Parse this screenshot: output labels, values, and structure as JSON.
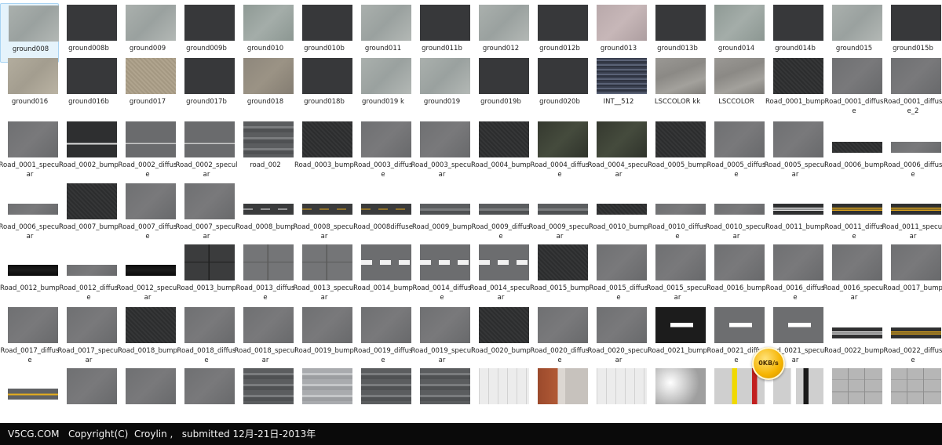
{
  "files": [
    {
      "label": "ground008",
      "tex": "tex-gray-light",
      "selected": true
    },
    {
      "label": "ground008b",
      "tex": "tex-dark"
    },
    {
      "label": "ground009",
      "tex": "tex-gray-light"
    },
    {
      "label": "ground009b",
      "tex": "tex-dark"
    },
    {
      "label": "ground010",
      "tex": "tex-gray-green"
    },
    {
      "label": "ground010b",
      "tex": "tex-dark"
    },
    {
      "label": "ground011",
      "tex": "tex-gray-light"
    },
    {
      "label": "ground011b",
      "tex": "tex-dark"
    },
    {
      "label": "ground012",
      "tex": "tex-gray-light"
    },
    {
      "label": "ground012b",
      "tex": "tex-dark"
    },
    {
      "label": "ground013",
      "tex": "tex-pink"
    },
    {
      "label": "ground013b",
      "tex": "tex-dark"
    },
    {
      "label": "ground014",
      "tex": "tex-gray-green"
    },
    {
      "label": "ground014b",
      "tex": "tex-dark"
    },
    {
      "label": "ground015",
      "tex": "tex-gray-light"
    },
    {
      "label": "ground015b",
      "tex": "tex-dark"
    },
    {
      "label": "ground016",
      "tex": "tex-beige"
    },
    {
      "label": "ground016b",
      "tex": "tex-dark"
    },
    {
      "label": "ground017",
      "tex": "tex-sand"
    },
    {
      "label": "ground017b",
      "tex": "tex-dark"
    },
    {
      "label": "ground018",
      "tex": "tex-brown-gray"
    },
    {
      "label": "ground018b",
      "tex": "tex-dark"
    },
    {
      "label": "ground019 k",
      "tex": "tex-gray-light"
    },
    {
      "label": "ground019",
      "tex": "tex-gray-light"
    },
    {
      "label": "ground019b",
      "tex": "tex-dark"
    },
    {
      "label": "ground020b",
      "tex": "tex-dark"
    },
    {
      "label": "INT__512",
      "tex": "tex-strip-blue"
    },
    {
      "label": "LSCCOLOR kk",
      "tex": "tex-concrete"
    },
    {
      "label": "LSCCOLOR",
      "tex": "tex-concrete"
    },
    {
      "label": "Road_0001_bump",
      "tex": "tex-asphalt-dark"
    },
    {
      "label": "Road_0001_diffuse",
      "tex": "tex-asphalt"
    },
    {
      "label": "Road_0001_diffuse_2",
      "tex": "tex-asphalt"
    },
    {
      "label": "Road_0001_specular",
      "tex": "tex-asphalt"
    },
    {
      "label": "Road_0002_bump",
      "tex": "tex-asphalt-dark-line"
    },
    {
      "label": "Road_0002_diffuse",
      "tex": "tex-asphalt-line"
    },
    {
      "label": "Road_0002_specular",
      "tex": "tex-asphalt-line"
    },
    {
      "label": "road_002",
      "tex": "tex-road-stripe"
    },
    {
      "label": "Road_0003_bump",
      "tex": "tex-asphalt-dark"
    },
    {
      "label": "Road_0003_diffuse",
      "tex": "tex-asphalt"
    },
    {
      "label": "Road_0003_specular",
      "tex": "tex-asphalt"
    },
    {
      "label": "Road_0004_bump",
      "tex": "tex-asphalt-dark"
    },
    {
      "label": "Road_0004_diffuse",
      "tex": "tex-asphalt-moss"
    },
    {
      "label": "Road_0004_specular",
      "tex": "tex-asphalt-moss"
    },
    {
      "label": "Road_0005_bump",
      "tex": "tex-asphalt-dark"
    },
    {
      "label": "Road_0005_diffuse",
      "tex": "tex-asphalt"
    },
    {
      "label": "Road_0005_specular",
      "tex": "tex-asphalt"
    },
    {
      "label": "Road_0006_bump",
      "tex": "tex-asphalt-dark",
      "short": true
    },
    {
      "label": "Road_0006_diffuse",
      "tex": "tex-asphalt",
      "short": true
    },
    {
      "label": "Road_0006_specular",
      "tex": "tex-asphalt",
      "short": true
    },
    {
      "label": "Road_0007_bump",
      "tex": "tex-asphalt-dark"
    },
    {
      "label": "Road_0007_diffuse",
      "tex": "tex-asphalt"
    },
    {
      "label": "Road_0007_specular",
      "tex": "tex-asphalt"
    },
    {
      "label": "Road_0008_bump",
      "tex": "tex-dash-white",
      "short": true
    },
    {
      "label": "Road_0008_specular",
      "tex": "tex-dash-yellow",
      "short": true
    },
    {
      "label": "Road_0008diffuse",
      "tex": "tex-dash-yellow",
      "short": true
    },
    {
      "label": "Road_0009_bump",
      "tex": "tex-road-stripe",
      "short": true
    },
    {
      "label": "Road_0009_diffuse",
      "tex": "tex-road-stripe",
      "short": true
    },
    {
      "label": "Road_0009_specular",
      "tex": "tex-road-stripe",
      "short": true
    },
    {
      "label": "Road_0010_bump",
      "tex": "tex-asphalt-dark",
      "short": true
    },
    {
      "label": "Road_0010_diffuse",
      "tex": "tex-asphalt",
      "short": true
    },
    {
      "label": "Road_0010_specular",
      "tex": "tex-asphalt",
      "short": true
    },
    {
      "label": "Road_0011_bump",
      "tex": "tex-double-white",
      "short": true
    },
    {
      "label": "Road_0011_diffuse",
      "tex": "tex-double-yellow",
      "short": true
    },
    {
      "label": "Road_0011_specular",
      "tex": "tex-double-yellow",
      "short": true
    },
    {
      "label": "Road_0012_bump",
      "tex": "tex-black-strip",
      "short": true
    },
    {
      "label": "Road_0012_diffuse",
      "tex": "tex-asphalt",
      "short": true
    },
    {
      "label": "Road_0012_specular",
      "tex": "tex-black-strip",
      "short": true
    },
    {
      "label": "Road_0013_bump",
      "tex": "tex-tiles-dark"
    },
    {
      "label": "Road_0013_diffuse",
      "tex": "tex-tiles"
    },
    {
      "label": "Road_0013_specular",
      "tex": "tex-tiles"
    },
    {
      "label": "Road_0014_bump",
      "tex": "tex-dash-center"
    },
    {
      "label": "Road_0014_diffuse",
      "tex": "tex-dash-center"
    },
    {
      "label": "Road_0014_specular",
      "tex": "tex-dash-center"
    },
    {
      "label": "Road_0015_bump",
      "tex": "tex-asphalt-dark"
    },
    {
      "label": "Road_0015_diffuse",
      "tex": "tex-asphalt"
    },
    {
      "label": "Road_0015_specular",
      "tex": "tex-asphalt"
    },
    {
      "label": "Road_0016_bump",
      "tex": "tex-asphalt"
    },
    {
      "label": "Road_0016_diffuse",
      "tex": "tex-asphalt"
    },
    {
      "label": "Road_0016_specular",
      "tex": "tex-asphalt"
    },
    {
      "label": "Road_0017_bump",
      "tex": "tex-asphalt"
    },
    {
      "label": "Road_0017_diffuse",
      "tex": "tex-asphalt"
    },
    {
      "label": "Road_0017_specular",
      "tex": "tex-asphalt"
    },
    {
      "label": "Road_0018_bump",
      "tex": "tex-asphalt-dark"
    },
    {
      "label": "Road_0018_diffuse",
      "tex": "tex-asphalt"
    },
    {
      "label": "Road_0018_specular",
      "tex": "tex-asphalt"
    },
    {
      "label": "Road_0019_bump",
      "tex": "tex-asphalt"
    },
    {
      "label": "Road_0019_diffuse",
      "tex": "tex-asphalt"
    },
    {
      "label": "Road_0019_specular",
      "tex": "tex-asphalt"
    },
    {
      "label": "Road_0020_bump",
      "tex": "tex-asphalt-dark"
    },
    {
      "label": "Road_0020_diffuse",
      "tex": "tex-asphalt"
    },
    {
      "label": "Road_0020_specular",
      "tex": "tex-asphalt"
    },
    {
      "label": "Road_0021_bump",
      "tex": "tex-mark-black"
    },
    {
      "label": "Road_0021_diffuse",
      "tex": "tex-mark-gray"
    },
    {
      "label": "Road_0021_specular",
      "tex": "tex-mark-gray"
    },
    {
      "label": "Road_0022_bump",
      "tex": "tex-double-white",
      "short": true
    },
    {
      "label": "Road_0022_diffuse",
      "tex": "tex-double-yellow",
      "short": true
    },
    {
      "label": "",
      "tex": "tex-single-yellow",
      "short": true
    },
    {
      "label": "",
      "tex": "tex-asphalt"
    },
    {
      "label": "",
      "tex": "tex-asphalt"
    },
    {
      "label": "",
      "tex": "tex-asphalt"
    },
    {
      "label": "",
      "tex": "tex-road-stripe"
    },
    {
      "label": "",
      "tex": "tex-road-light"
    },
    {
      "label": "",
      "tex": "tex-road-stripe"
    },
    {
      "label": "",
      "tex": "tex-road-stripe"
    },
    {
      "label": "",
      "tex": "tex-sketch"
    },
    {
      "label": "",
      "tex": "tex-brick"
    },
    {
      "label": "",
      "tex": "tex-sketch"
    },
    {
      "label": "",
      "tex": "tex-cloud"
    },
    {
      "label": "",
      "tex": "tex-lane-yellow"
    },
    {
      "label": "",
      "tex": "tex-lane-white"
    },
    {
      "label": "",
      "tex": "tex-tile-gray"
    },
    {
      "label": "",
      "tex": "tex-tile-gray"
    }
  ],
  "badge": {
    "label": "0KB/s"
  },
  "footer": {
    "text": "V5CG.COM   Copyright(C)  Croylin ,   submitted 12月-21日-2013年"
  }
}
